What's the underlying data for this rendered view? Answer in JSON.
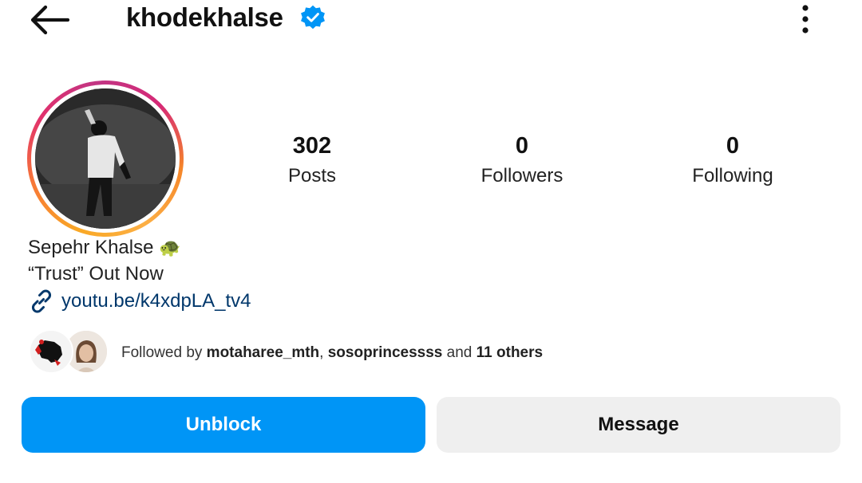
{
  "header": {
    "username": "khodekhalse",
    "verified": true,
    "icons": {
      "back": "arrow-left-icon",
      "verified": "verified-badge-icon",
      "more": "more-vertical-icon"
    }
  },
  "stats": [
    {
      "value": "302",
      "label": "Posts"
    },
    {
      "value": "0",
      "label": "Followers"
    },
    {
      "value": "0",
      "label": "Following"
    }
  ],
  "profile": {
    "display_name": "Sepehr Khalse",
    "display_emoji": "🐢",
    "bio": "“Trust” Out Now",
    "link": "youtu.be/k4xdpLA_tv4",
    "link_icon": "link-icon"
  },
  "followed_by": {
    "prefix": "Followed by ",
    "user1": "motaharee_mth",
    "separator": ", ",
    "user2": "sosoprincessss",
    "conjunction": " and ",
    "others": "11 others"
  },
  "actions": {
    "unblock_label": "Unblock",
    "message_label": "Message"
  },
  "colors": {
    "primary_button": "#0095f6",
    "secondary_button": "#efefef",
    "link": "#00376b",
    "verified": "#0095f6"
  }
}
